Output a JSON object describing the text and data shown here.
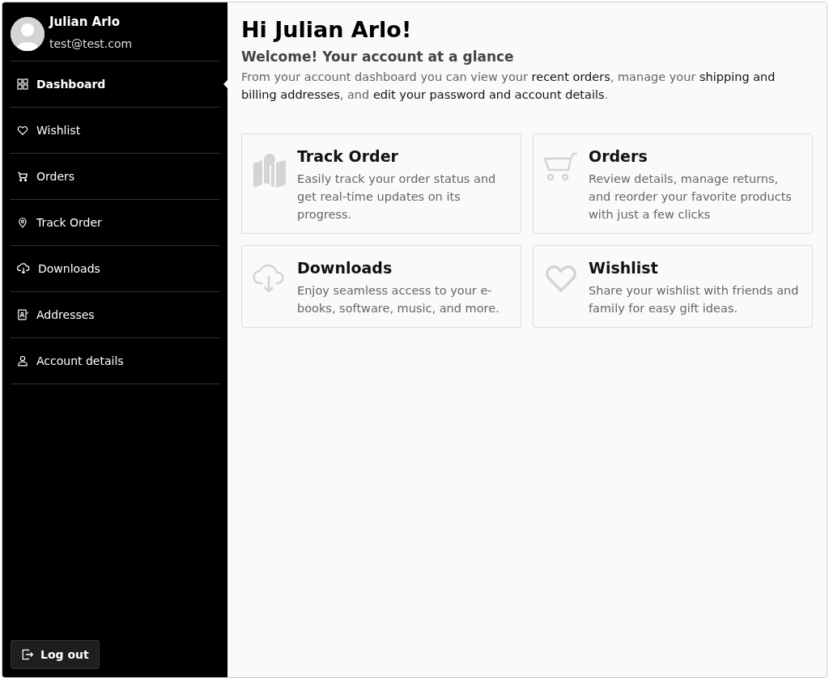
{
  "user": {
    "name": "Julian Arlo",
    "email": "test@test.com"
  },
  "nav": [
    {
      "kind": "grid",
      "label": "Dashboard",
      "selected": true
    },
    {
      "kind": "heart",
      "label": "Wishlist",
      "selected": false
    },
    {
      "kind": "cart",
      "label": "Orders",
      "selected": false
    },
    {
      "kind": "pin",
      "label": "Track Order",
      "selected": false
    },
    {
      "kind": "cloud",
      "label": "Downloads",
      "selected": false
    },
    {
      "kind": "contact",
      "label": "Addresses",
      "selected": false
    },
    {
      "kind": "person",
      "label": "Account details",
      "selected": false
    }
  ],
  "logout": "Log out",
  "greeting": "Hi Julian Arlo!",
  "subtitle": "Welcome! Your account at a glance",
  "intro": "From your account dashboard you can view your **recent orders**, manage your **shipping and billing addresses**, and **edit your password and account details**.",
  "cards": [
    {
      "kind": "map",
      "title": "Track Order",
      "text": "Easily track your order status and get real-time updates on its progress."
    },
    {
      "kind": "cart",
      "title": "Orders",
      "text": "Review details, manage returns, and reorder your favorite products with just a few clicks"
    },
    {
      "kind": "cloud",
      "title": "Downloads",
      "text": "Enjoy seamless access to your e-books, software, music, and more."
    },
    {
      "kind": "heart",
      "title": "Wishlist",
      "text": "Share your wishlist with friends and family for easy gift ideas."
    }
  ]
}
